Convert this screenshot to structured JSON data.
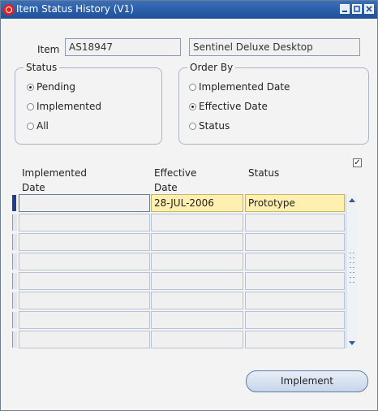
{
  "window": {
    "title": "Item Status History (V1)",
    "controls": [
      "minimize-icon",
      "maximize-icon",
      "close-icon"
    ]
  },
  "item": {
    "label": "Item",
    "code": "AS18947",
    "description": "Sentinel Deluxe Desktop"
  },
  "status_group": {
    "title": "Status",
    "options": [
      {
        "label": "Pending",
        "selected": true
      },
      {
        "label": "Implemented",
        "selected": false
      },
      {
        "label": "All",
        "selected": false
      }
    ]
  },
  "order_group": {
    "title": "Order By",
    "options": [
      {
        "label": "Implemented Date",
        "selected": false
      },
      {
        "label": "Effective Date",
        "selected": true
      },
      {
        "label": "Status",
        "selected": false
      }
    ]
  },
  "table": {
    "columns": [
      {
        "line1": "Implemented",
        "line2": "Date"
      },
      {
        "line1": "Effective",
        "line2": "Date"
      },
      {
        "line1": "",
        "line2": "Status"
      }
    ],
    "rows": [
      [
        "",
        "28-JUL-2006",
        "Prototype"
      ],
      [
        "",
        "",
        ""
      ],
      [
        "",
        "",
        ""
      ],
      [
        "",
        "",
        ""
      ],
      [
        "",
        "",
        ""
      ],
      [
        "",
        "",
        ""
      ],
      [
        "",
        "",
        ""
      ],
      [
        "",
        "",
        ""
      ]
    ],
    "checkbox_checked": true
  },
  "buttons": {
    "implement": "Implement"
  }
}
